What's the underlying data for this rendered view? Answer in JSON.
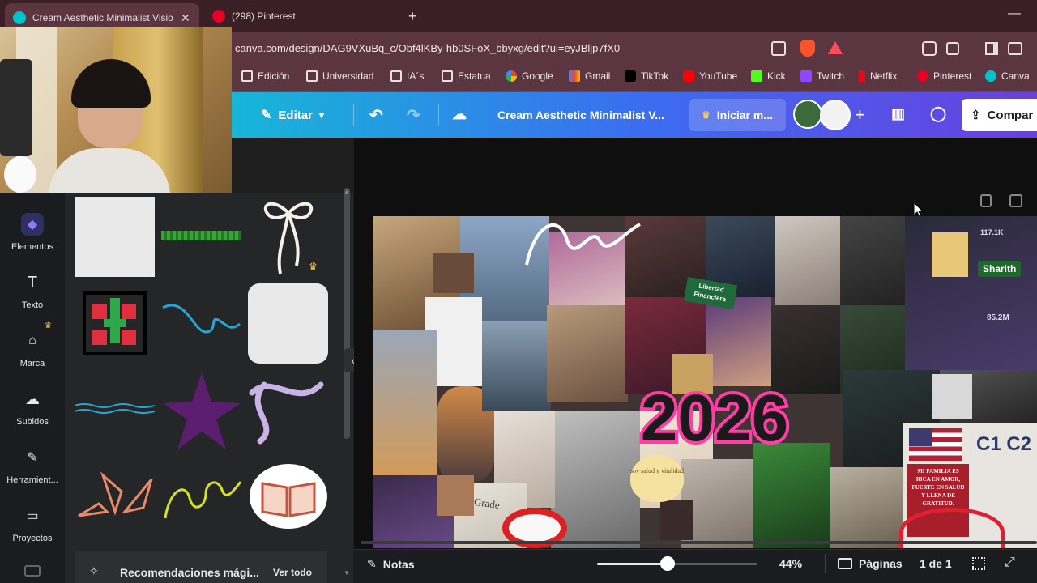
{
  "browser": {
    "tabs": [
      {
        "title": "Cream Aesthetic Minimalist Visio",
        "active": true
      },
      {
        "title": "(298) Pinterest",
        "active": false
      }
    ],
    "new_tab_symbol": "+",
    "url": "canva.com/design/DAG9VXuBq_c/Obf4lKBy-hb0SFoX_bbyxg/edit?ui=eyJBljp7fX0",
    "bookmarks": [
      "Edición",
      "Universidad",
      "IA´s",
      "Estatua",
      "Google",
      "Gmail",
      "TikTok",
      "YouTube",
      "Kick",
      "Twitch",
      "Netflix",
      "Pinterest",
      "Canva"
    ]
  },
  "canva_header": {
    "edit_label": "Editar",
    "design_title": "Cream Aesthetic Minimalist V...",
    "upgrade_label": "Iniciar m...",
    "share_label": "Compar"
  },
  "rail": {
    "items": [
      "Elementos",
      "Texto",
      "Marca",
      "Subidos",
      "Herramient...",
      "Proyectos"
    ]
  },
  "panel": {
    "recommendations_label": "Recomendaciones mági...",
    "see_all_label": "Ver todo"
  },
  "collage": {
    "year": "2026",
    "tags": [
      "Sharith",
      "C1 C2",
      "Libertad Financiera",
      "soy salud y vitalidad",
      "Grade",
      "MI FAMILIA ES RICA EN AMOR, FUERTE EN SALUD Y LLENA DE GRATITUD.",
      "117.1K",
      "85.2M"
    ]
  },
  "bottom": {
    "notes_label": "Notas",
    "zoom": "44%",
    "zoom_fraction": 0.44,
    "pages_label": "Páginas",
    "page_indicator": "1 de 1"
  },
  "colors": {
    "tab_bg": "#3a1f26",
    "chrome_bg": "#5b3540",
    "canva_gradient_start": "#17b6d8",
    "canva_gradient_end": "#6a3fe0",
    "year_fill": "#1a1a1a",
    "year_stroke": "#ff3ea5"
  }
}
